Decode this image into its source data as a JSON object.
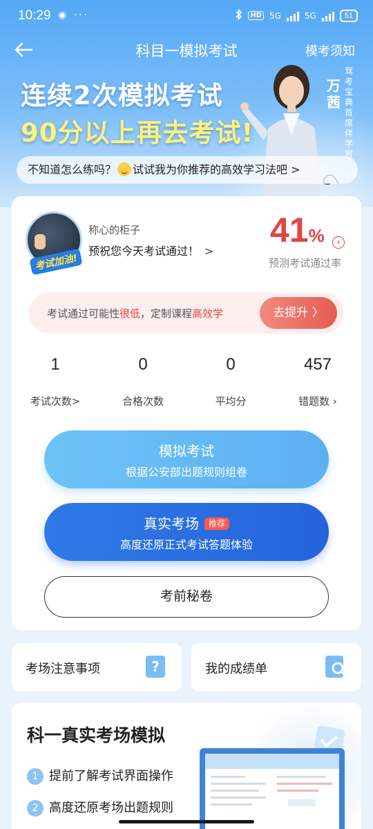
{
  "status_bar": {
    "time": "10:29",
    "left_icons": "◉ ···",
    "network_hd": "HD",
    "network_1": "5G",
    "network_2": "5G",
    "battery": "51"
  },
  "nav": {
    "title": "科目一模拟考试",
    "notice": "模考须知"
  },
  "hero": {
    "slogan_line1": "连续2次模拟考试",
    "slogan_line2": "90分以上再去考试!",
    "mentor_name": "万茜",
    "mentor_title": "驾考宝典首席伴学官",
    "tip_before": "不知道怎么练吗？",
    "tip_after": "试试我为你推荐的高效学习法吧 >"
  },
  "user": {
    "name": "称心的柜子",
    "avatar_badge": "考试加油!",
    "wish": "预祝您今天考试通过！",
    "wish_chevron": ">",
    "pass_rate_value": "41",
    "pass_rate_unit": "%",
    "pass_rate_label": "预测考试通过率"
  },
  "improve": {
    "text_1": "考试通过可能性",
    "text_low": "很低",
    "text_2": "，定制课程",
    "text_eff": "高效学",
    "button": "去提升 〉"
  },
  "stats": [
    {
      "value": "1",
      "label": "考试次数>"
    },
    {
      "value": "0",
      "label": "合格次数"
    },
    {
      "value": "0",
      "label": "平均分"
    },
    {
      "value": "457",
      "label": "错题数 ›"
    }
  ],
  "buttons": {
    "mock_title": "模拟考试",
    "mock_sub": "根据公安部出题规则组卷",
    "real_title": "真实考场",
    "real_tag": "推荐",
    "real_sub": "高度还原正式考试答题体验",
    "secret": "考前秘卷"
  },
  "tiles": {
    "notes": "考场注意事项",
    "scores": "我的成绩单"
  },
  "bottom": {
    "heading": "科一真实考场模拟",
    "items": [
      {
        "n": "1",
        "text": "提前了解考试界面操作"
      },
      {
        "n": "2",
        "text": "高度还原考场出题规则"
      }
    ]
  },
  "colors": {
    "accent_blue": "#2f7ae6",
    "light_blue": "#6cc3f6",
    "warning_red": "#e44545",
    "slogan_yellow": "#fff27a"
  }
}
